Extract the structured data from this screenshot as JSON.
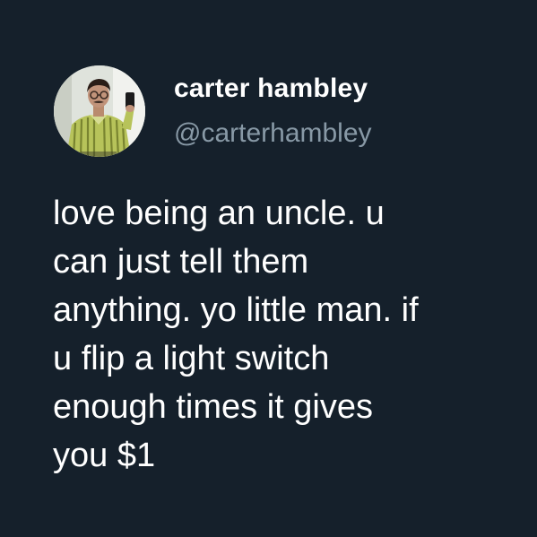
{
  "profile": {
    "display_name": "carter hambley",
    "handle": "@carterhambley",
    "avatar_icon": "profile-photo"
  },
  "tweet": {
    "lines": [
      "love being an uncle. u",
      "can just tell them",
      "anything. yo little man. if",
      "u flip a light switch",
      "enough times it gives",
      "you $1"
    ]
  },
  "colors": {
    "background": "#15202b",
    "text_primary": "#ffffff",
    "text_secondary": "#8899a6"
  }
}
